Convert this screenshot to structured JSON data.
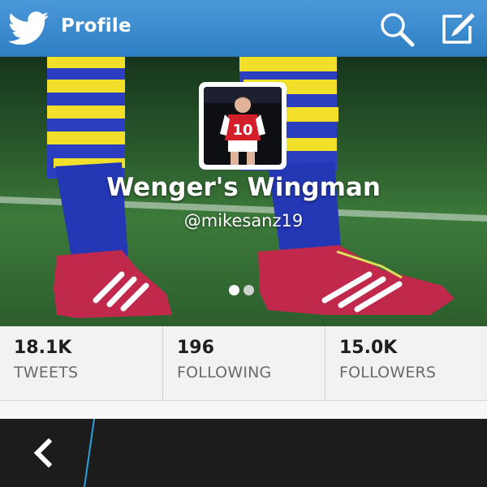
{
  "header": {
    "title": "Profile",
    "logo_icon": "twitter-bird-icon",
    "search_icon": "search-icon",
    "compose_icon": "compose-icon"
  },
  "profile": {
    "display_name": "Wenger's Wingman",
    "handle": "@mikesanz19",
    "avatar_jersey_number": "10"
  },
  "pager": {
    "pages": 2,
    "active_index": 0
  },
  "stats": [
    {
      "value": "18.1K",
      "label": "TWEETS"
    },
    {
      "value": "196",
      "label": "FOLLOWING"
    },
    {
      "value": "15.0K",
      "label": "FOLLOWERS"
    }
  ],
  "bottom_bar": {
    "back_icon": "chevron-left-icon"
  },
  "colors": {
    "header_blue": "#3a8bd0",
    "accent_blue": "#29a3e0",
    "bottom_bar": "#1c1c1c",
    "stats_background": "#f2f2f2"
  }
}
